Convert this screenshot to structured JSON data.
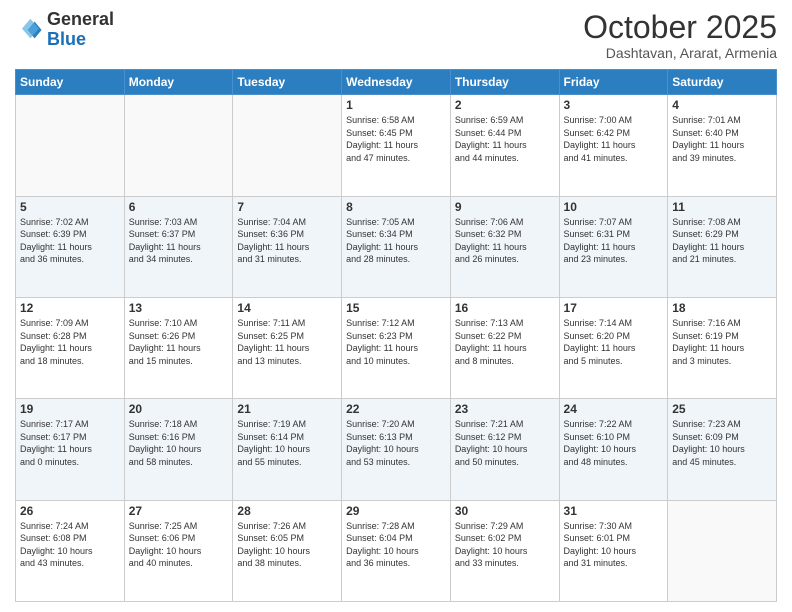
{
  "logo": {
    "general": "General",
    "blue": "Blue"
  },
  "header": {
    "month": "October 2025",
    "location": "Dashtavan, Ararat, Armenia"
  },
  "days_of_week": [
    "Sunday",
    "Monday",
    "Tuesday",
    "Wednesday",
    "Thursday",
    "Friday",
    "Saturday"
  ],
  "weeks": [
    [
      {
        "day": "",
        "info": ""
      },
      {
        "day": "",
        "info": ""
      },
      {
        "day": "",
        "info": ""
      },
      {
        "day": "1",
        "info": "Sunrise: 6:58 AM\nSunset: 6:45 PM\nDaylight: 11 hours\nand 47 minutes."
      },
      {
        "day": "2",
        "info": "Sunrise: 6:59 AM\nSunset: 6:44 PM\nDaylight: 11 hours\nand 44 minutes."
      },
      {
        "day": "3",
        "info": "Sunrise: 7:00 AM\nSunset: 6:42 PM\nDaylight: 11 hours\nand 41 minutes."
      },
      {
        "day": "4",
        "info": "Sunrise: 7:01 AM\nSunset: 6:40 PM\nDaylight: 11 hours\nand 39 minutes."
      }
    ],
    [
      {
        "day": "5",
        "info": "Sunrise: 7:02 AM\nSunset: 6:39 PM\nDaylight: 11 hours\nand 36 minutes."
      },
      {
        "day": "6",
        "info": "Sunrise: 7:03 AM\nSunset: 6:37 PM\nDaylight: 11 hours\nand 34 minutes."
      },
      {
        "day": "7",
        "info": "Sunrise: 7:04 AM\nSunset: 6:36 PM\nDaylight: 11 hours\nand 31 minutes."
      },
      {
        "day": "8",
        "info": "Sunrise: 7:05 AM\nSunset: 6:34 PM\nDaylight: 11 hours\nand 28 minutes."
      },
      {
        "day": "9",
        "info": "Sunrise: 7:06 AM\nSunset: 6:32 PM\nDaylight: 11 hours\nand 26 minutes."
      },
      {
        "day": "10",
        "info": "Sunrise: 7:07 AM\nSunset: 6:31 PM\nDaylight: 11 hours\nand 23 minutes."
      },
      {
        "day": "11",
        "info": "Sunrise: 7:08 AM\nSunset: 6:29 PM\nDaylight: 11 hours\nand 21 minutes."
      }
    ],
    [
      {
        "day": "12",
        "info": "Sunrise: 7:09 AM\nSunset: 6:28 PM\nDaylight: 11 hours\nand 18 minutes."
      },
      {
        "day": "13",
        "info": "Sunrise: 7:10 AM\nSunset: 6:26 PM\nDaylight: 11 hours\nand 15 minutes."
      },
      {
        "day": "14",
        "info": "Sunrise: 7:11 AM\nSunset: 6:25 PM\nDaylight: 11 hours\nand 13 minutes."
      },
      {
        "day": "15",
        "info": "Sunrise: 7:12 AM\nSunset: 6:23 PM\nDaylight: 11 hours\nand 10 minutes."
      },
      {
        "day": "16",
        "info": "Sunrise: 7:13 AM\nSunset: 6:22 PM\nDaylight: 11 hours\nand 8 minutes."
      },
      {
        "day": "17",
        "info": "Sunrise: 7:14 AM\nSunset: 6:20 PM\nDaylight: 11 hours\nand 5 minutes."
      },
      {
        "day": "18",
        "info": "Sunrise: 7:16 AM\nSunset: 6:19 PM\nDaylight: 11 hours\nand 3 minutes."
      }
    ],
    [
      {
        "day": "19",
        "info": "Sunrise: 7:17 AM\nSunset: 6:17 PM\nDaylight: 11 hours\nand 0 minutes."
      },
      {
        "day": "20",
        "info": "Sunrise: 7:18 AM\nSunset: 6:16 PM\nDaylight: 10 hours\nand 58 minutes."
      },
      {
        "day": "21",
        "info": "Sunrise: 7:19 AM\nSunset: 6:14 PM\nDaylight: 10 hours\nand 55 minutes."
      },
      {
        "day": "22",
        "info": "Sunrise: 7:20 AM\nSunset: 6:13 PM\nDaylight: 10 hours\nand 53 minutes."
      },
      {
        "day": "23",
        "info": "Sunrise: 7:21 AM\nSunset: 6:12 PM\nDaylight: 10 hours\nand 50 minutes."
      },
      {
        "day": "24",
        "info": "Sunrise: 7:22 AM\nSunset: 6:10 PM\nDaylight: 10 hours\nand 48 minutes."
      },
      {
        "day": "25",
        "info": "Sunrise: 7:23 AM\nSunset: 6:09 PM\nDaylight: 10 hours\nand 45 minutes."
      }
    ],
    [
      {
        "day": "26",
        "info": "Sunrise: 7:24 AM\nSunset: 6:08 PM\nDaylight: 10 hours\nand 43 minutes."
      },
      {
        "day": "27",
        "info": "Sunrise: 7:25 AM\nSunset: 6:06 PM\nDaylight: 10 hours\nand 40 minutes."
      },
      {
        "day": "28",
        "info": "Sunrise: 7:26 AM\nSunset: 6:05 PM\nDaylight: 10 hours\nand 38 minutes."
      },
      {
        "day": "29",
        "info": "Sunrise: 7:28 AM\nSunset: 6:04 PM\nDaylight: 10 hours\nand 36 minutes."
      },
      {
        "day": "30",
        "info": "Sunrise: 7:29 AM\nSunset: 6:02 PM\nDaylight: 10 hours\nand 33 minutes."
      },
      {
        "day": "31",
        "info": "Sunrise: 7:30 AM\nSunset: 6:01 PM\nDaylight: 10 hours\nand 31 minutes."
      },
      {
        "day": "",
        "info": ""
      }
    ]
  ],
  "row_shades": [
    false,
    true,
    false,
    true,
    false
  ]
}
